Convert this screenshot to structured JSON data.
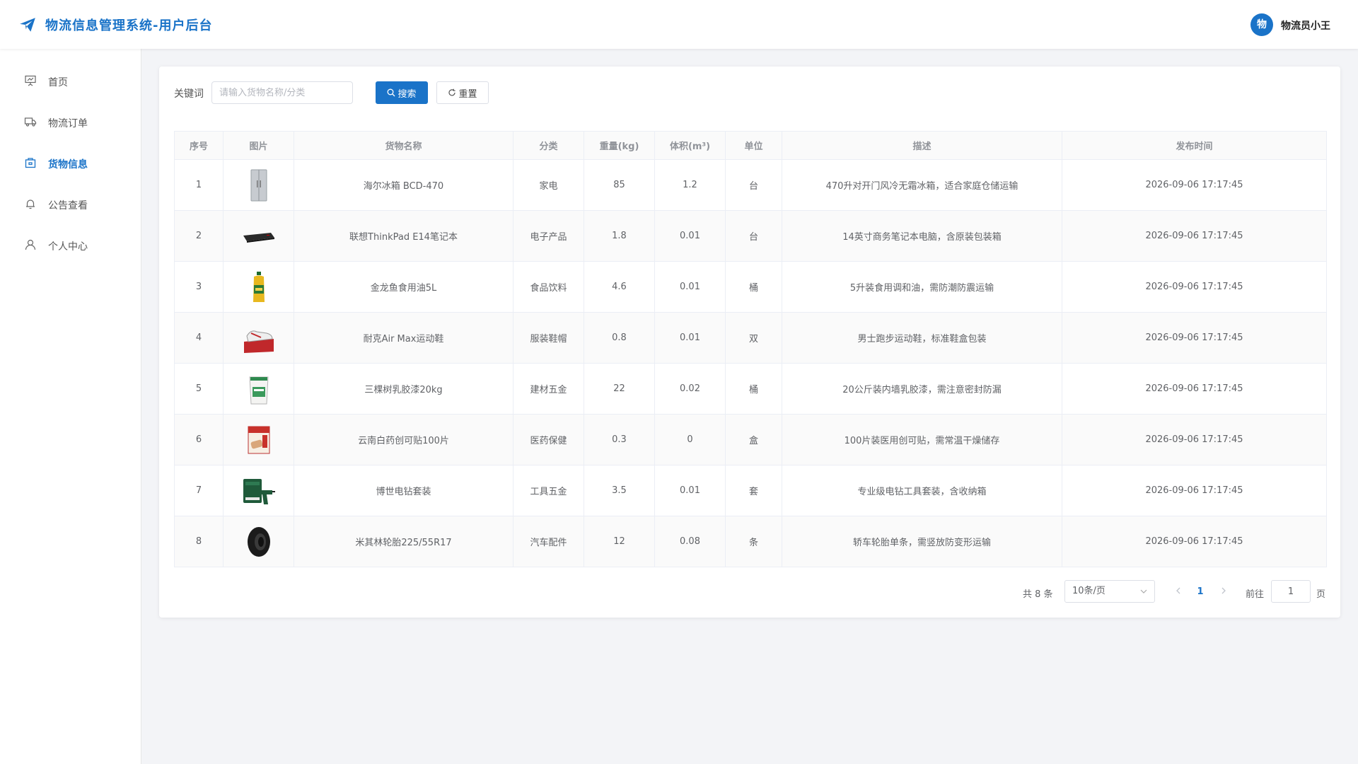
{
  "header": {
    "title": "物流信息管理系统-用户后台",
    "avatar_text": "物",
    "username": "物流员小王"
  },
  "colors": {
    "accent": "#1a73c8"
  },
  "sidebar": {
    "items": [
      {
        "label": "首页",
        "icon": "presentation-board-icon",
        "active": false
      },
      {
        "label": "物流订单",
        "icon": "truck-icon",
        "active": false
      },
      {
        "label": "货物信息",
        "icon": "package-icon",
        "active": true
      },
      {
        "label": "公告查看",
        "icon": "bell-icon",
        "active": false
      },
      {
        "label": "个人中心",
        "icon": "user-icon",
        "active": false
      }
    ]
  },
  "search": {
    "label": "关键词",
    "placeholder": "请输入货物名称/分类",
    "value": "",
    "search_label": "搜索",
    "reset_label": "重置"
  },
  "table": {
    "headers": [
      "序号",
      "图片",
      "货物名称",
      "分类",
      "重量(kg)",
      "体积(m³)",
      "单位",
      "描述",
      "发布时间"
    ],
    "rows": [
      {
        "no": "1",
        "image": "refrigerator-image",
        "name": "海尔冰箱 BCD-470",
        "category": "家电",
        "weight": "85",
        "volume": "1.2",
        "unit": "台",
        "desc": "470升对开门风冷无霜冰箱，适合家庭仓储运输",
        "time": "2026-09-06 17:17:45"
      },
      {
        "no": "2",
        "image": "laptop-image",
        "name": "联想ThinkPad E14笔记本",
        "category": "电子产品",
        "weight": "1.8",
        "volume": "0.01",
        "unit": "台",
        "desc": "14英寸商务笔记本电脑，含原装包装箱",
        "time": "2026-09-06 17:17:45"
      },
      {
        "no": "3",
        "image": "oil-bottle-image",
        "name": "金龙鱼食用油5L",
        "category": "食品饮料",
        "weight": "4.6",
        "volume": "0.01",
        "unit": "桶",
        "desc": "5升装食用调和油，需防潮防震运输",
        "time": "2026-09-06 17:17:45"
      },
      {
        "no": "4",
        "image": "sneakers-image",
        "name": "耐克Air Max运动鞋",
        "category": "服装鞋帽",
        "weight": "0.8",
        "volume": "0.01",
        "unit": "双",
        "desc": "男士跑步运动鞋，标准鞋盒包装",
        "time": "2026-09-06 17:17:45"
      },
      {
        "no": "5",
        "image": "paint-bucket-image",
        "name": "三棵树乳胶漆20kg",
        "category": "建材五金",
        "weight": "22",
        "volume": "0.02",
        "unit": "桶",
        "desc": "20公斤装内墙乳胶漆，需注意密封防漏",
        "time": "2026-09-06 17:17:45"
      },
      {
        "no": "6",
        "image": "bandage-box-image",
        "name": "云南白药创可贴100片",
        "category": "医药保健",
        "weight": "0.3",
        "volume": "0",
        "unit": "盒",
        "desc": "100片装医用创可贴，需常温干燥储存",
        "time": "2026-09-06 17:17:45"
      },
      {
        "no": "7",
        "image": "drill-kit-image",
        "name": "博世电钻套装",
        "category": "工具五金",
        "weight": "3.5",
        "volume": "0.01",
        "unit": "套",
        "desc": "专业级电钻工具套装，含收纳箱",
        "time": "2026-09-06 17:17:45"
      },
      {
        "no": "8",
        "image": "tire-image",
        "name": "米其林轮胎225/55R17",
        "category": "汽车配件",
        "weight": "12",
        "volume": "0.08",
        "unit": "条",
        "desc": "轿车轮胎单条，需竖放防变形运输",
        "time": "2026-09-06 17:17:45"
      }
    ]
  },
  "pagination": {
    "total_text": "共 8 条",
    "page_size": "10条/页",
    "current_page": "1",
    "goto_label": "前往",
    "goto_value": "1",
    "page_suffix": "页"
  }
}
